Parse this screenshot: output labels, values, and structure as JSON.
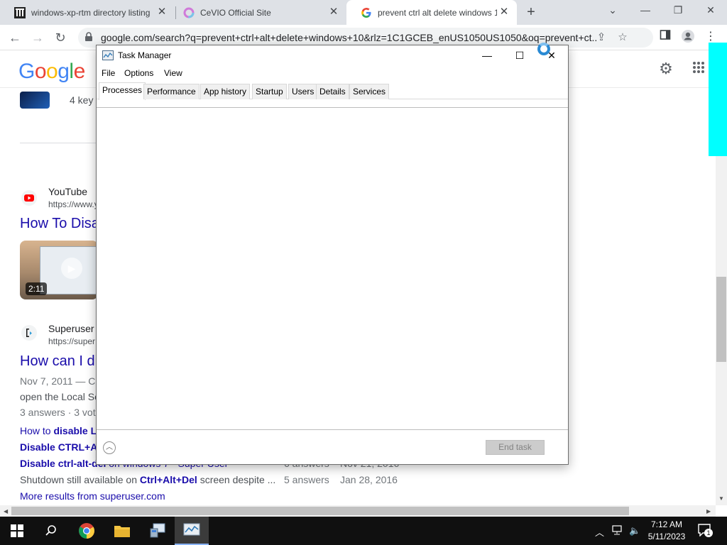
{
  "browser": {
    "tabs": [
      {
        "title": "windows-xp-rtm directory listing",
        "icon": "archive-icon"
      },
      {
        "title": "CeVIO Official Site",
        "icon": "cevio-icon"
      },
      {
        "title": "prevent ctrl alt delete windows 1",
        "icon": "google-icon"
      }
    ],
    "url": "google.com/search?q=prevent+ctrl+alt+delete+windows+10&rlz=1C1GCEB_enUS1050US1050&oq=prevent+ct..."
  },
  "google": {
    "logo": "Google",
    "top_snippet": "4 key",
    "results": [
      {
        "site": "YouTube",
        "url": "https://www.y",
        "title": "How To Disa",
        "duration": "2:11"
      },
      {
        "site": "Superuser",
        "url": "https://super",
        "title": "How can I di",
        "date_line": "Nov 7, 2011 — C",
        "snippet": "open the Local Se",
        "answers_line": "3 answers · 3 vot"
      }
    ],
    "sublinks": [
      {
        "pre": "How to ",
        "bold": "disable Lo",
        "post": "",
        "answers": "",
        "date": ""
      },
      {
        "pre": "",
        "bold": "Disable CTRL+AL",
        "post": "",
        "answers": "",
        "date": ""
      },
      {
        "pre": "",
        "bold": "Disable ctrl-alt-del",
        "post": " on windows 7 - Super User",
        "answers": "6 answers",
        "date": "Nov 21, 2016"
      },
      {
        "pre": "Shutdown still available on ",
        "bold": "Ctrl+Alt+Del",
        "post": " screen despite ...",
        "answers": "5 answers",
        "date": "Jan 28, 2016"
      }
    ],
    "more_results": "More results from superuser.com"
  },
  "task_manager": {
    "title": "Task Manager",
    "menu": [
      "File",
      "Options",
      "View"
    ],
    "tabs": [
      "Processes",
      "Performance",
      "App history",
      "Startup",
      "Users",
      "Details",
      "Services"
    ],
    "active_tab": "Processes",
    "end_task": "End task"
  },
  "taskbar": {
    "time": "7:12 AM",
    "date": "5/11/2023",
    "notification_count": "1"
  }
}
